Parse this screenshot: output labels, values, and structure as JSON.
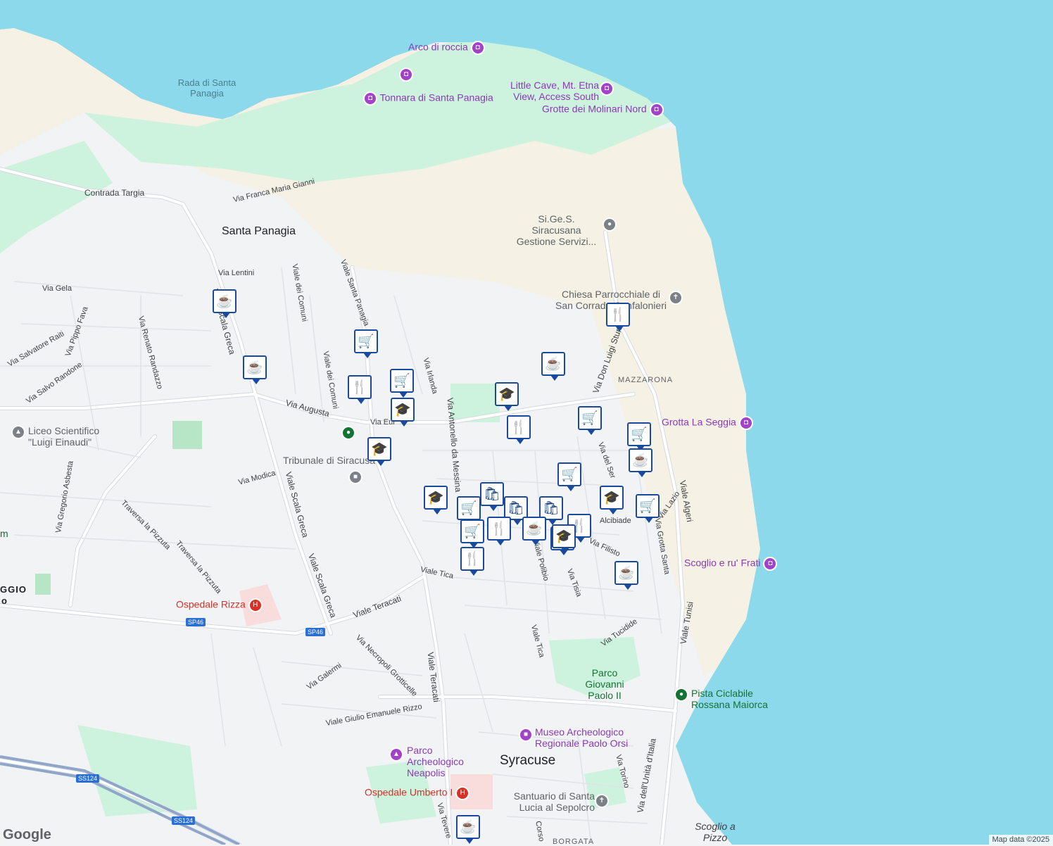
{
  "labels": {
    "water_santa_panagia": "Rada di Santa Panagia",
    "arco_di_roccia": "Arco di roccia",
    "tonnara": "Tonnara di Santa Panagia",
    "little_cave": "Little Cave, Mt. Etna View, Access South",
    "grotte_molinari": "Grotte dei Molinari Nord",
    "sigess": "Si.Ge.S. Siracusana Gestione Servizi...",
    "chiesa": "Chiesa Parrocchiale di San Corrado Confalonieri",
    "grotta_seggia": "Grotta La Seggia",
    "scoglio_frati": "Scoglio e ru' Frati",
    "liceo": "Liceo Scientifico \"Luigi Einaudi\"",
    "tribunale": "Tribunale di Siracusa",
    "ospedale_rizza": "Ospedale Rizza",
    "parco_giovanni": "Parco Giovanni Paolo II",
    "pista_ciclabile": "Pista Ciclabile Rossana Maiorca",
    "museo": "Museo Archeologico Regionale Paolo Orsi",
    "parco_neapolis": "Parco Archeologico Neapolis",
    "ospedale_umberto": "Ospedale Umberto I",
    "santuario": "Santuario di Santa Lucia al Sepolcro",
    "scoglio_pizzo": "Scoglio a Pizzo",
    "santa_panagia": "Santa Panagia",
    "syracuse": "Syracuse",
    "mazzarona": "MAZZARONA",
    "borgata": "BORGATA",
    "ggio": "GGIO",
    "o_partial": "o",
    "m_partial": "m"
  },
  "roads": {
    "contrada_targia": "Contrada Targia",
    "via_franca": "Via Franca Maria Gianni",
    "via_lentini": "Via Lentini",
    "via_gela": "Via Gela",
    "viale_comuni1": "Viale dei Comuni",
    "viale_comuni2": "Viale dei Comuni",
    "viale_santa_panagia": "Viale Santa Panagia",
    "via_pippo_fava": "Via Pippo Fava",
    "via_salvatore_raiti": "Via Salvatore Raiti",
    "via_renato_randazzo": "Via Renato Randazzo",
    "via_salvo_randone": "Via Salvo Randone",
    "viale_scala_greca1": "Viale Scala Greca",
    "viale_scala_greca2": "Viale Scala Greca",
    "viale_scala_greca3": "Viale Scala Greca",
    "via_augusta": "Via Augusta",
    "via_irlanda": "Via Irlanda",
    "via_antonello": "Via Antonello da Messina",
    "via_don_luigi": "Via Don Luigi Sturzo",
    "via_modica": "Via Modica",
    "via_gregorio": "Via Gregorio Asbesta",
    "traversa_pizzuta1": "Traversa la Pizzuta",
    "traversa_pizzuta2": "Traversa la Pizzuta",
    "viale_teracati1": "Viale Teracati",
    "viale_teracati2": "Viale Teracati",
    "viale_tica1": "Viale Tica",
    "viale_tica2": "Viale Tica",
    "via_necropoli": "Via Necropoli Grotticelle",
    "via_galermi": "Via Galermi",
    "viale_giulio": "Viale Giulio Emanuele Rizzo",
    "via_tucidide": "Via Tucidide",
    "via_tisia": "Via Tisia",
    "viale_polibio": "Viale Polibio",
    "via_filisto": "Via Filisto",
    "via_alcibiade": "Alcibiade",
    "via_grotta_santa": "Via Grotta Santa",
    "viale_algeri": "Viale Algeri",
    "viale_tunisi": "Viale Tunisi",
    "via_unita": "Via dell'Unità d'Italia",
    "via_torino": "Via Torino",
    "via_tevere": "Via Tevere",
    "corso": "Corso",
    "via_lazio": "Via Lazio",
    "via_del_ser": "Via del Ser",
    "via_eur": "Via Eur"
  },
  "shields": {
    "sp46a": "SP46",
    "sp46b": "SP46",
    "ss124a": "SS124",
    "ss124b": "SS124"
  },
  "pins": [
    {
      "icon": "cafe-icon",
      "glyph": "☕"
    },
    {
      "icon": "cafe-icon",
      "glyph": "☕"
    },
    {
      "icon": "grocery-icon",
      "glyph": "🛒"
    },
    {
      "icon": "restaurant-icon",
      "glyph": "🍴"
    },
    {
      "icon": "grocery-icon",
      "glyph": "🛒"
    },
    {
      "icon": "school-icon",
      "glyph": "🎓"
    },
    {
      "icon": "school-icon",
      "glyph": "🎓"
    },
    {
      "icon": "school-icon",
      "glyph": "🎓"
    },
    {
      "icon": "cafe-icon",
      "glyph": "☕"
    },
    {
      "icon": "school-icon",
      "glyph": "🎓"
    },
    {
      "icon": "restaurant-icon",
      "glyph": "🍴"
    },
    {
      "icon": "restaurant-icon",
      "glyph": "🍴"
    },
    {
      "icon": "grocery-icon",
      "glyph": "🛒"
    },
    {
      "icon": "grocery-icon",
      "glyph": "🛒"
    },
    {
      "icon": "cafe-icon",
      "glyph": "☕"
    },
    {
      "icon": "grocery-icon",
      "glyph": "🛒"
    },
    {
      "icon": "school-icon",
      "glyph": "🎓"
    },
    {
      "icon": "grocery-icon",
      "glyph": "🛒"
    },
    {
      "icon": "school-icon",
      "glyph": "🎓"
    },
    {
      "icon": "grocery-icon",
      "glyph": "🛒"
    },
    {
      "icon": "shopping-icon",
      "glyph": "🛍"
    },
    {
      "icon": "shopping-icon",
      "glyph": "🛍"
    },
    {
      "icon": "shopping-icon",
      "glyph": "🛍"
    },
    {
      "icon": "grocery-icon",
      "glyph": "🛒"
    },
    {
      "icon": "restaurant-icon",
      "glyph": "🍴"
    },
    {
      "icon": "cafe-icon",
      "glyph": "☕"
    },
    {
      "icon": "restaurant-icon",
      "glyph": "🍴"
    },
    {
      "icon": "school-icon",
      "glyph": "🎓"
    },
    {
      "icon": "restaurant-icon",
      "glyph": "🍴"
    },
    {
      "icon": "cafe-icon",
      "glyph": "☕"
    },
    {
      "icon": "cafe-icon",
      "glyph": "☕"
    }
  ],
  "logo": "Google",
  "attribution": "Map data ©2025",
  "colors": {
    "water": "#8cd9ec",
    "park": "#cdf2dd",
    "sand": "#f5f1e4",
    "land": "#f1f3f4",
    "road": "#ffffff",
    "road_outline": "#d5dadf",
    "pin_border": "#1a4a9e",
    "purple_poi": "#8a3ab9"
  }
}
